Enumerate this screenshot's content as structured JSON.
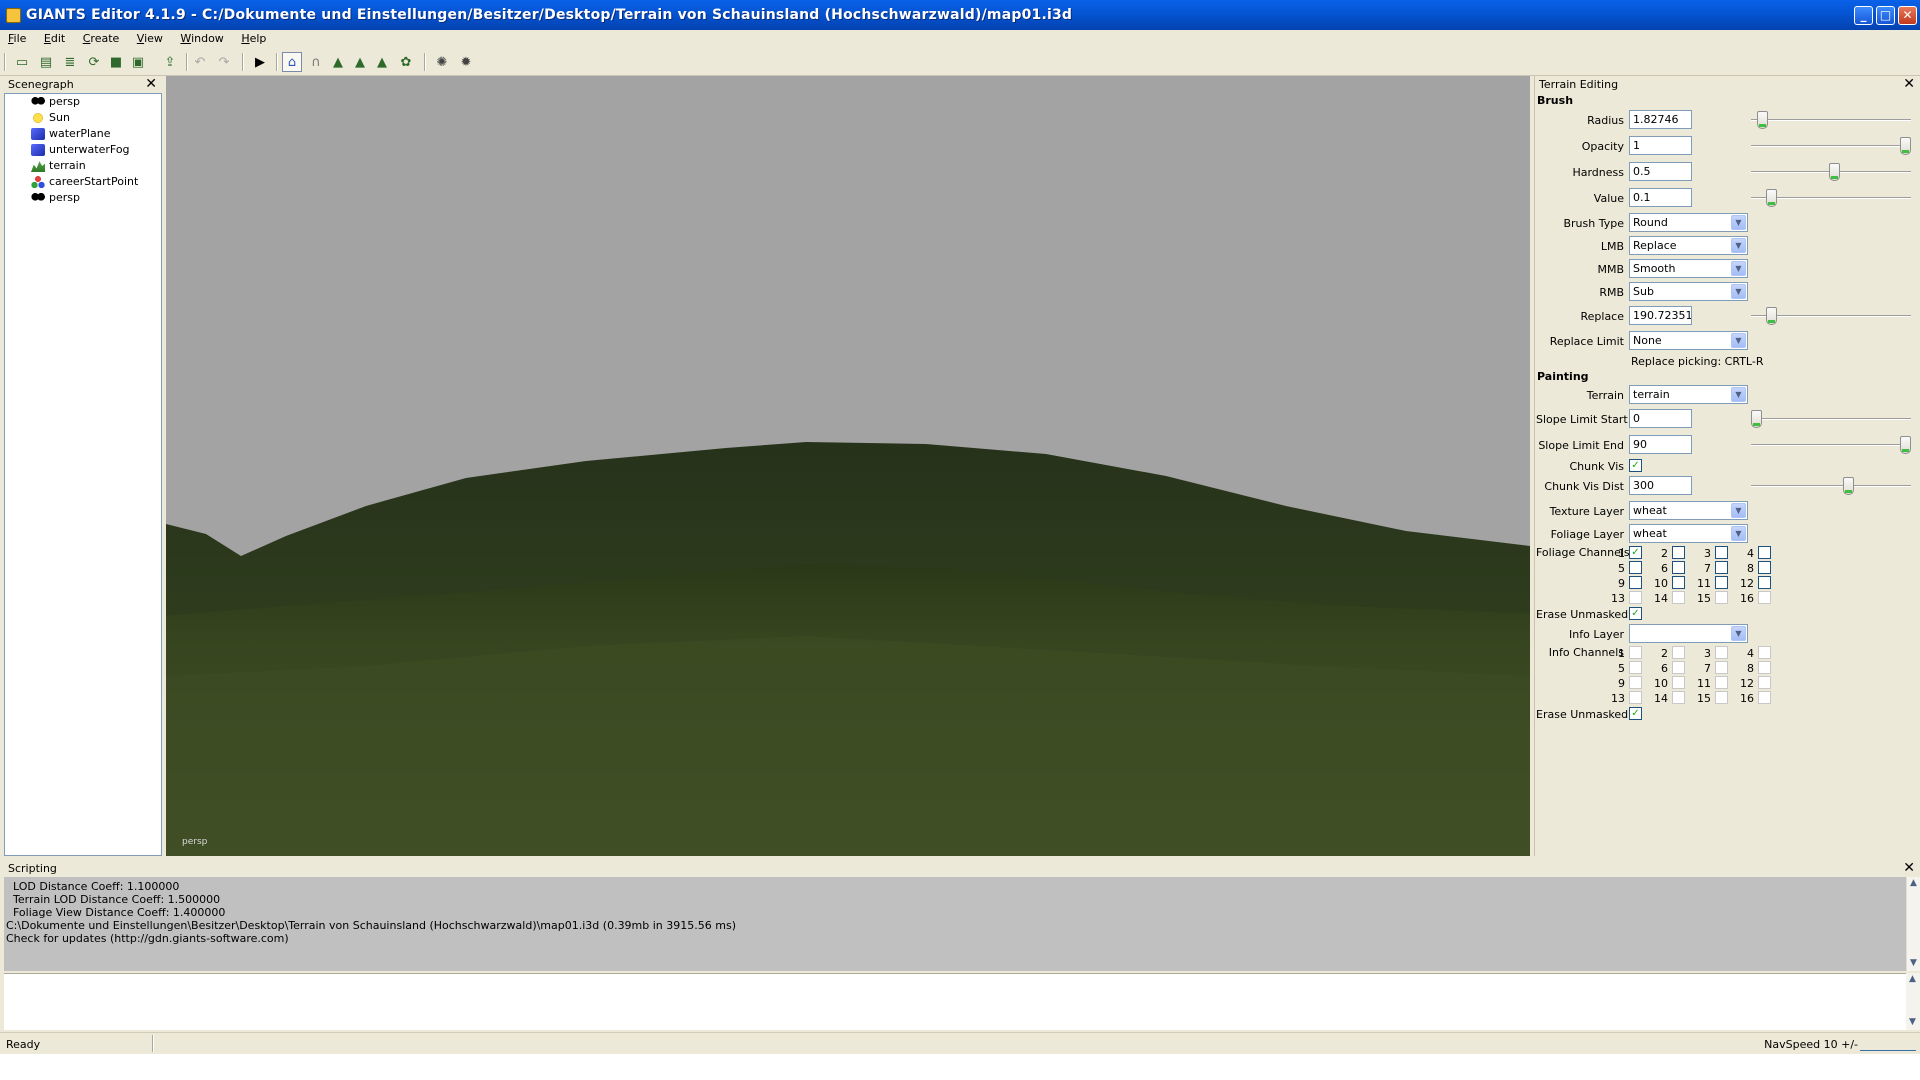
{
  "window": {
    "title": "GIANTS Editor 4.1.9 - C:/Dokumente und Einstellungen/Besitzer/Desktop/Terrain von Schauinsland (Hochschwarzwald)/map01.i3d",
    "minimize_glyph": "_",
    "maximize_glyph": "□",
    "close_glyph": "✕"
  },
  "menu": [
    "File",
    "Edit",
    "Create",
    "View",
    "Window",
    "Help"
  ],
  "toolbar": {
    "icons": [
      "new-file-icon",
      "open-file-icon",
      "list-icon",
      "refresh-icon",
      "save-icon",
      "save-all-icon",
      "import-icon",
      "undo-icon",
      "redo-icon",
      "play-icon",
      "home-icon",
      "magnet-icon",
      "terrain-sculpt-icon",
      "terrain-paint-icon",
      "terrain-foliage-icon",
      "grass-icon",
      "render-icon",
      "settings-render-icon"
    ],
    "glyphs": [
      "▭",
      "▤",
      "≣",
      "⟳",
      "■",
      "▣",
      "⇪",
      "↶",
      "↷",
      "▶",
      "⌂",
      "∩",
      "▲",
      "▲",
      "▲",
      "✿",
      "✺",
      "✹"
    ]
  },
  "scenegraph": {
    "title": "Scenegraph",
    "close_glyph": "✕",
    "items": [
      {
        "label": "persp",
        "icon": "camera-icon"
      },
      {
        "label": "Sun",
        "icon": "sun-icon"
      },
      {
        "label": "waterPlane",
        "icon": "cube-icon"
      },
      {
        "label": "unterwaterFog",
        "icon": "cube-icon"
      },
      {
        "label": "terrain",
        "icon": "terrain-icon"
      },
      {
        "label": "careerStartPoint",
        "icon": "start-point-icon"
      },
      {
        "label": "persp",
        "icon": "camera-icon"
      }
    ]
  },
  "viewport": {
    "camera_label": "persp",
    "sky_color": "#a3a3a3",
    "ground_color": "#3c4a22"
  },
  "terrain_panel": {
    "title": "Terrain Editing",
    "close_glyph": "✕",
    "combo_arrow": "▼",
    "check_glyph": "✓",
    "brush_section": "Brush",
    "radius": {
      "label": "Radius",
      "value": "1.82746",
      "slider": 0.04
    },
    "opacity": {
      "label": "Opacity",
      "value": "1",
      "slider": 1.0
    },
    "hardness": {
      "label": "Hardness",
      "value": "0.5",
      "slider": 0.5
    },
    "value": {
      "label": "Value",
      "value": "0.1",
      "slider": 0.1
    },
    "brush_type": {
      "label": "Brush Type",
      "value": "Round"
    },
    "lmb": {
      "label": "LMB",
      "value": "Replace"
    },
    "mmb": {
      "label": "MMB",
      "value": "Smooth"
    },
    "rmb": {
      "label": "RMB",
      "value": "Sub"
    },
    "replace": {
      "label": "Replace",
      "value": "190.72351",
      "slider": 0.1
    },
    "replace_limit": {
      "label": "Replace Limit",
      "value": "None"
    },
    "replace_note": "Replace picking: CRTL-R",
    "painting_section": "Painting",
    "terrain": {
      "label": "Terrain",
      "value": "terrain"
    },
    "slope_start": {
      "label": "Slope Limit Start",
      "value": "0",
      "slider": 0.0
    },
    "slope_end": {
      "label": "Slope Limit End",
      "value": "90",
      "slider": 1.0
    },
    "chunk_vis": {
      "label": "Chunk Vis",
      "checked": true
    },
    "chunk_vis_dist": {
      "label": "Chunk Vis Dist",
      "value": "300",
      "slider": 0.6
    },
    "texture_layer": {
      "label": "Texture Layer",
      "value": "wheat"
    },
    "foliage_layer": {
      "label": "Foliage Layer",
      "value": "wheat"
    },
    "foliage_channels": {
      "label": "Foliage Channels",
      "channels": [
        "1",
        "2",
        "3",
        "4",
        "5",
        "6",
        "7",
        "8",
        "9",
        "10",
        "11",
        "12",
        "13",
        "14",
        "15",
        "16"
      ],
      "checked": [
        true,
        false,
        false,
        false,
        false,
        false,
        false,
        false,
        false,
        false,
        false,
        false,
        false,
        false,
        false,
        false
      ],
      "enabled_count": 12
    },
    "erase_unmasked_1": {
      "label": "Erase Unmasked",
      "checked": true
    },
    "info_layer": {
      "label": "Info Layer",
      "value": ""
    },
    "info_channels": {
      "label": "Info Channels",
      "channels": [
        "1",
        "2",
        "3",
        "4",
        "5",
        "6",
        "7",
        "8",
        "9",
        "10",
        "11",
        "12",
        "13",
        "14",
        "15",
        "16"
      ]
    },
    "erase_unmasked_2": {
      "label": "Erase Unmasked",
      "checked": true
    }
  },
  "scripting": {
    "title": "Scripting",
    "close_glyph": "✕",
    "log_lines": [
      "  LOD Distance Coeff: 1.100000",
      "  Terrain LOD Distance Coeff: 1.500000",
      "  Foliage View Distance Coeff: 1.400000",
      "C:\\Dokumente und Einstellungen\\Besitzer\\Desktop\\Terrain von Schauinsland (Hochschwarzwald)\\map01.i3d (0.39mb in 3915.56 ms)",
      "Check for updates (http://gdn.giants-software.com)"
    ],
    "scroll_up": "▲",
    "scroll_down": "▼"
  },
  "statusbar": {
    "status": "Ready",
    "navspeed": "NavSpeed 10 +/-"
  }
}
